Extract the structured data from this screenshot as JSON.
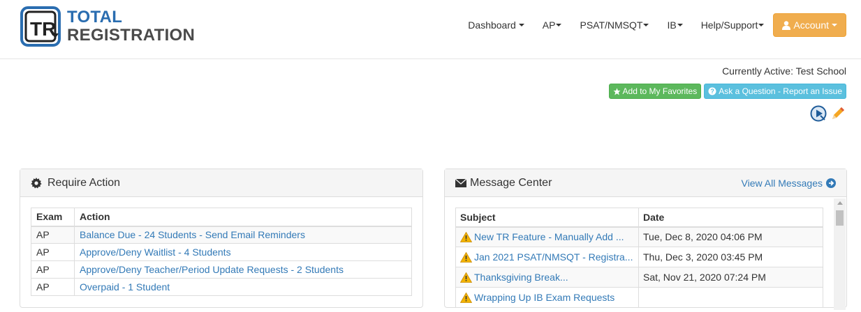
{
  "brand": {
    "line1": "TOTAL",
    "line2": "REGISTRATION",
    "monogram": "TR"
  },
  "nav": {
    "items": [
      {
        "label": "Dashboard"
      },
      {
        "label": "AP"
      },
      {
        "label": "PSAT/NMSQT"
      },
      {
        "label": "IB"
      },
      {
        "label": "Help/Support"
      }
    ],
    "account": {
      "label": "Account",
      "icon": "user-icon"
    }
  },
  "status": {
    "active_line": "Currently Active: Test School"
  },
  "actions": {
    "favorites_label": "Add to My Favorites",
    "question_label": "Ask a Question - Report an Issue",
    "favorites_icon": "star-icon",
    "question_icon": "question-circle-icon",
    "tool_icons": [
      "play-help-icon",
      "pencil-icon"
    ]
  },
  "require_action": {
    "title": "Require Action",
    "icon": "gear-icon",
    "headers": {
      "exam": "Exam",
      "action": "Action"
    },
    "rows": [
      {
        "exam": "AP",
        "action": "Balance Due - 24 Students - Send Email Reminders"
      },
      {
        "exam": "AP",
        "action": "Approve/Deny Waitlist - 4 Students"
      },
      {
        "exam": "AP",
        "action": "Approve/Deny Teacher/Period Update Requests - 2 Students"
      },
      {
        "exam": "AP",
        "action": "Overpaid - 1 Student"
      }
    ]
  },
  "message_center": {
    "title": "Message Center",
    "icon": "envelope-icon",
    "view_all": "View All Messages",
    "view_all_icon": "arrow-circle-right-icon",
    "headers": {
      "subject": "Subject",
      "date": "Date"
    },
    "rows": [
      {
        "subject": "New TR Feature - Manually Add ...",
        "date": "Tue, Dec 8, 2020 04:06 PM"
      },
      {
        "subject": "Jan 2021 PSAT/NMSQT - Registra...",
        "date": "Thu, Dec 3, 2020 03:45 PM"
      },
      {
        "subject": "Thanksgiving Break...",
        "date": "Sat, Nov 21, 2020 07:24 PM"
      },
      {
        "subject": "Wrapping Up IB Exam Requests",
        "date": ""
      }
    ]
  },
  "colors": {
    "link": "#337ab7",
    "account_btn": "#f0ad4e",
    "favorites_btn": "#5cb85c",
    "question_btn": "#5bc0de",
    "highlight": "#fff34d",
    "brand_blue": "#2a6db0"
  }
}
